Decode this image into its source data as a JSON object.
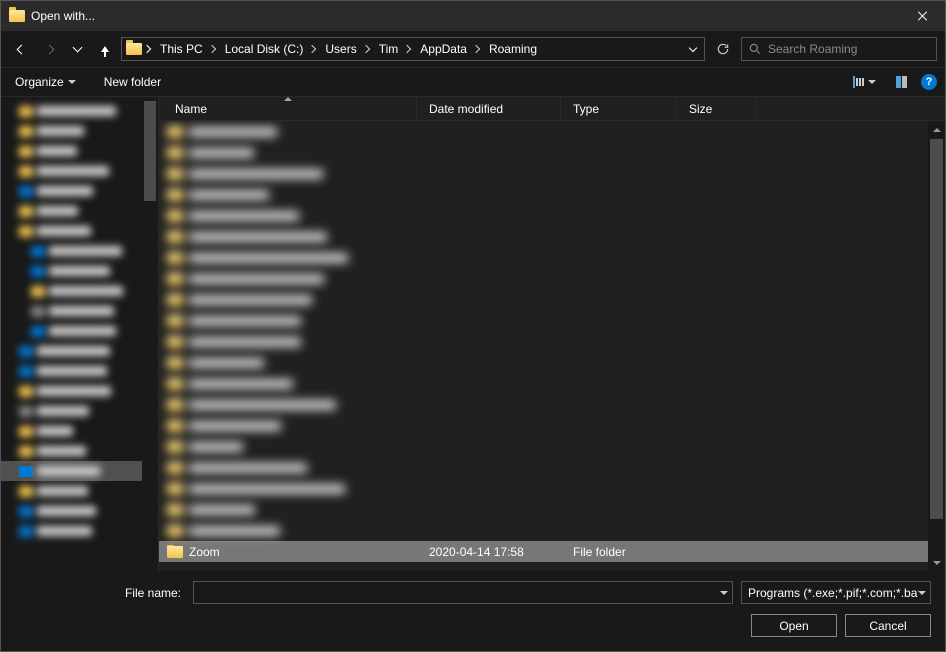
{
  "title": "Open with...",
  "breadcrumb": [
    "This PC",
    "Local Disk (C:)",
    "Users",
    "Tim",
    "AppData",
    "Roaming"
  ],
  "search_placeholder": "Search Roaming",
  "toolbar": {
    "organize": "Organize",
    "new_folder": "New folder"
  },
  "columns": {
    "name": "Name",
    "date": "Date modified",
    "type": "Type",
    "size": "Size"
  },
  "selected_row": {
    "name": "Zoom",
    "date": "2020-04-14 17:58",
    "type": "File folder",
    "size": ""
  },
  "filename_label": "File name:",
  "filename_value": "",
  "filter_label": "Programs (*.exe;*.pif;*.com;*.bat)",
  "buttons": {
    "open": "Open",
    "cancel": "Cancel"
  }
}
